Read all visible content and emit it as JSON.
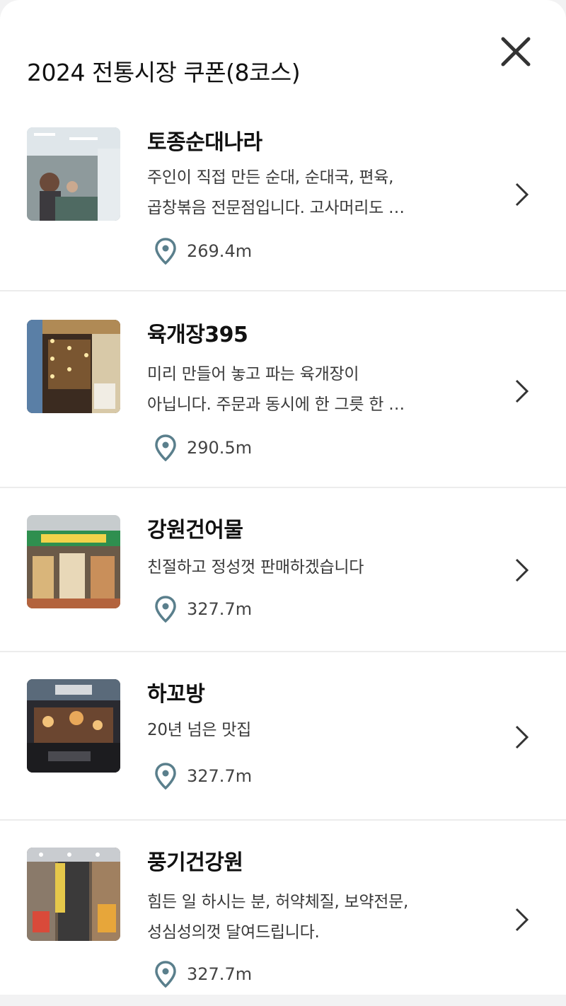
{
  "header": {
    "title": "2024 전통시장 쿠폰(8코스)",
    "close_icon": "close-icon"
  },
  "colors": {
    "pin": "#5a7f8c",
    "chevron": "#333333",
    "divider": "#ececec"
  },
  "stores": [
    {
      "name": "토종순대나라",
      "desc": [
        "주인이 직접 만든 순대, 순대국, 편육,",
        "곱창볶음 전문점입니다. 고사머리도 …"
      ],
      "distance": "269.4m"
    },
    {
      "name": "육개장395",
      "desc": [
        "미리 만들어 놓고 파는 육개장이",
        "아닙니다. 주문과 동시에 한 그릇 한 …"
      ],
      "distance": "290.5m"
    },
    {
      "name": "강원건어물",
      "desc": [
        "친절하고 정성껏 판매하겠습니다"
      ],
      "distance": "327.7m"
    },
    {
      "name": "하꼬방",
      "desc": [
        "20년 넘은 맛집"
      ],
      "distance": "327.7m"
    },
    {
      "name": "풍기건강원",
      "desc": [
        "힘든 일 하시는 분, 허약체질, 보약전문,",
        "성심성의껏 달여드립니다."
      ],
      "distance": "327.7m"
    }
  ]
}
